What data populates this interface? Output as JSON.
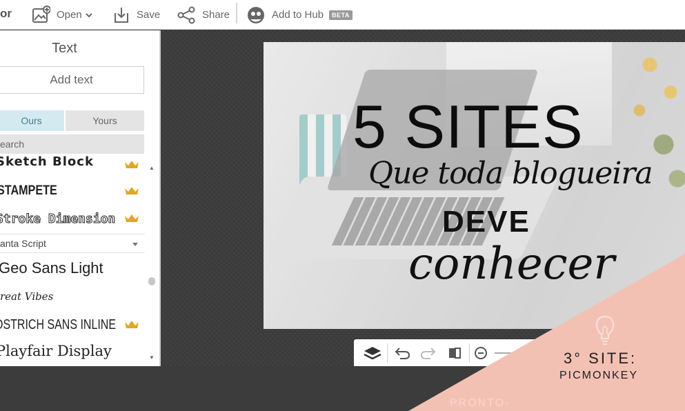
{
  "toolbar": {
    "left_fragment": "or",
    "open_label": "Open",
    "save_label": "Save",
    "share_label": "Share",
    "hub_label": "Add to Hub",
    "hub_badge": "BETA"
  },
  "panel": {
    "title": "Text",
    "add_text_label": "Add text",
    "tabs": [
      {
        "label": "Ours",
        "active": true
      },
      {
        "label": "Yours",
        "active": false
      }
    ],
    "search_placeholder": "earch",
    "fonts": [
      {
        "label": "Sketch Block",
        "premium": true
      },
      {
        "label": "STAMPETE",
        "premium": true
      },
      {
        "label": "Stroke Dimension",
        "premium": true
      },
      {
        "label": "Geo Sans Light",
        "premium": false
      },
      {
        "label": "Great Vibes",
        "premium": false
      },
      {
        "label": "OSTRICH SANS INLINE",
        "premium": true
      },
      {
        "label": "Playfair Display",
        "premium": false
      }
    ],
    "selected_font": "anta Script"
  },
  "canvas": {
    "headline": "5 SITES",
    "line2": "Que toda blogueira",
    "line3": "DEVE",
    "line4": "conhecer"
  },
  "watermark": {
    "site_label": "3° SITE:",
    "site_name": "PICMONKEY",
    "url": "PRONTO-POSTEI.BLOGSPOT.COM.BR",
    "color": "#f3c1b4"
  },
  "icons": {
    "open": "image-add-icon",
    "save": "save-icon",
    "share": "share-icon",
    "hub": "hub-icon",
    "crown": "crown-icon",
    "bulb": "lightbulb-icon"
  }
}
